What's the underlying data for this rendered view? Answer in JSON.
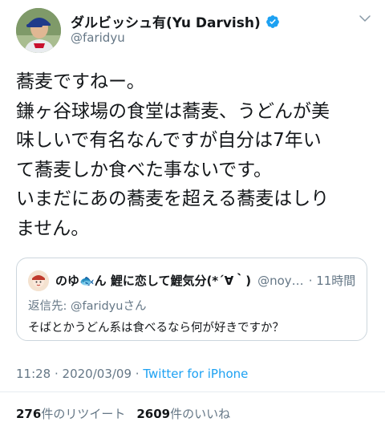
{
  "author": {
    "display_name": "ダルビッシュ有(Yu Darvish)",
    "handle": "@faridyu",
    "verified": true
  },
  "tweet": {
    "lines": [
      "蕎麦ですねー。",
      "鎌ヶ谷球場の食堂は蕎麦、うどんが美",
      "味しいで有名なんですが自分は7年い",
      "て蕎麦しか食べた事ないです。",
      "いまだにあの蕎麦を超える蕎麦はしり",
      "ません。"
    ]
  },
  "quoted_tweet": {
    "name": "のゆ🐟ん 鯉に恋して鯉気分(*´∀｀)",
    "handle": "@noy…",
    "time": "· 11時間",
    "reply_prefix": "返信先: ",
    "reply_mention": "@faridyuさん",
    "body": "そばとかうどん系は食べるなら何が好きですか？"
  },
  "meta": {
    "time": "11:28",
    "date": "2020/03/09",
    "separator1": " · ",
    "separator2": " · ",
    "source": "Twitter for iPhone"
  },
  "stats": {
    "retweets_count": "276",
    "retweets_label": "件のリツイート",
    "likes_count": "2609",
    "likes_label": "件のいいね"
  },
  "colors": {
    "link": "#1da1f2",
    "secondary_text": "#657786",
    "primary_text": "#14171a",
    "border": "#ccd6dd"
  },
  "icons": {
    "verified": "verified-badge-icon",
    "caret": "chevron-down-icon"
  }
}
